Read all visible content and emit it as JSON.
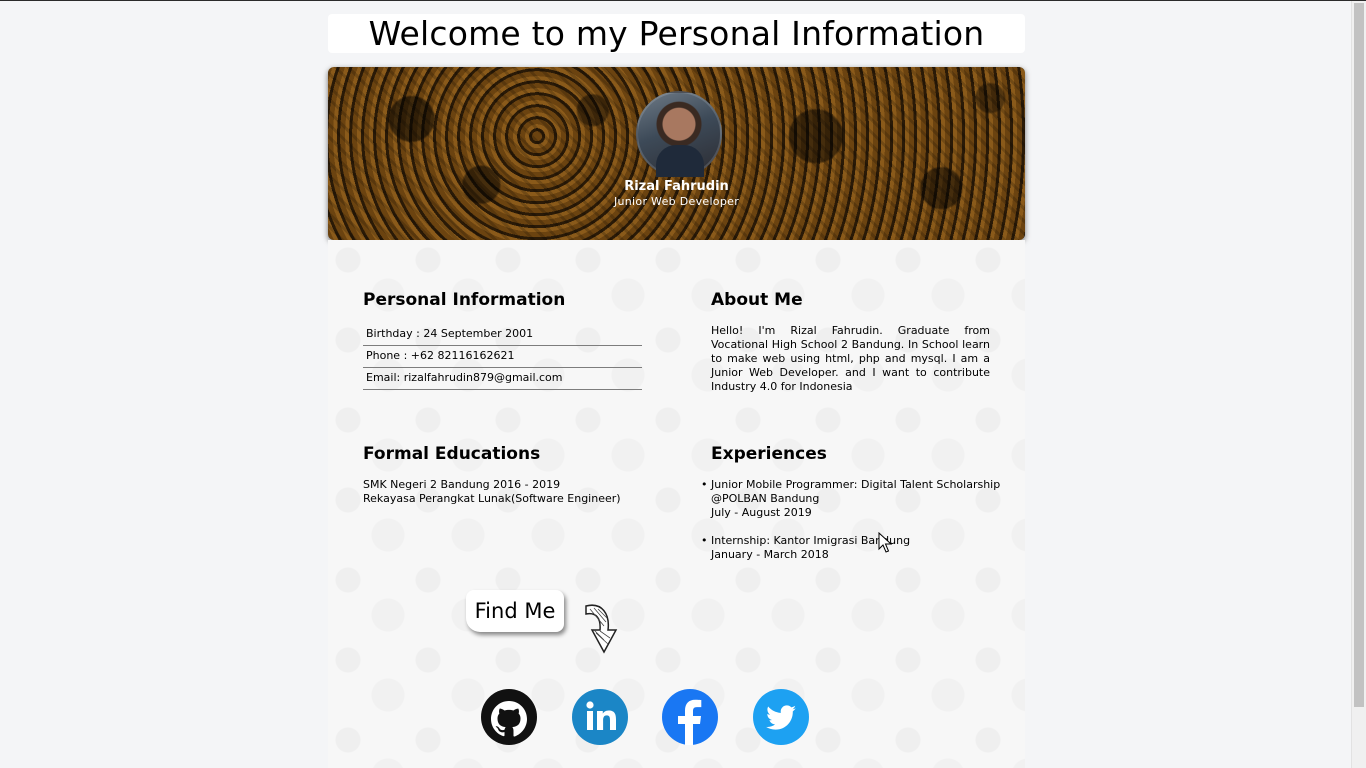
{
  "page": {
    "title": "Welcome to my Personal Information"
  },
  "profile": {
    "name": "Rizal Fahrudin",
    "role": "Junior Web Developer",
    "avatar_alt": "profile photo"
  },
  "personal_info": {
    "heading": "Personal Information",
    "rows": [
      "Birthday : 24 September 2001",
      "Phone : +62 82116162621",
      "Email: rizalfahrudin879@gmail.com"
    ]
  },
  "about": {
    "heading": "About Me",
    "text": "Hello! I'm Rizal Fahrudin. Graduate from Vocational High School 2 Bandung. In School learn to make web using html, php and mysql. I am a Junior Web Developer. and I want to contribute Industry 4.0 for Indonesia"
  },
  "education": {
    "heading": "Formal Educations",
    "lines": [
      "SMK Negeri 2 Bandung 2016 - 2019",
      "Rekayasa Perangkat Lunak(Software Engineer)"
    ]
  },
  "experiences": {
    "heading": "Experiences",
    "items": [
      {
        "title": "Junior Mobile Programmer: Digital Talent Scholarship @POLBAN Bandung",
        "period": "July - August 2019"
      },
      {
        "title": "Internship: Kantor Imigrasi Bandung",
        "period": "January - March 2018"
      }
    ]
  },
  "find_me": {
    "label": "Find Me"
  },
  "social": {
    "icons": [
      "github-icon",
      "linkedin-icon",
      "facebook-icon",
      "twitter-icon"
    ],
    "colors": {
      "github": "#111111",
      "linkedin": "#1b86c6",
      "facebook": "#1977f3",
      "twitter": "#1da1f2"
    }
  }
}
